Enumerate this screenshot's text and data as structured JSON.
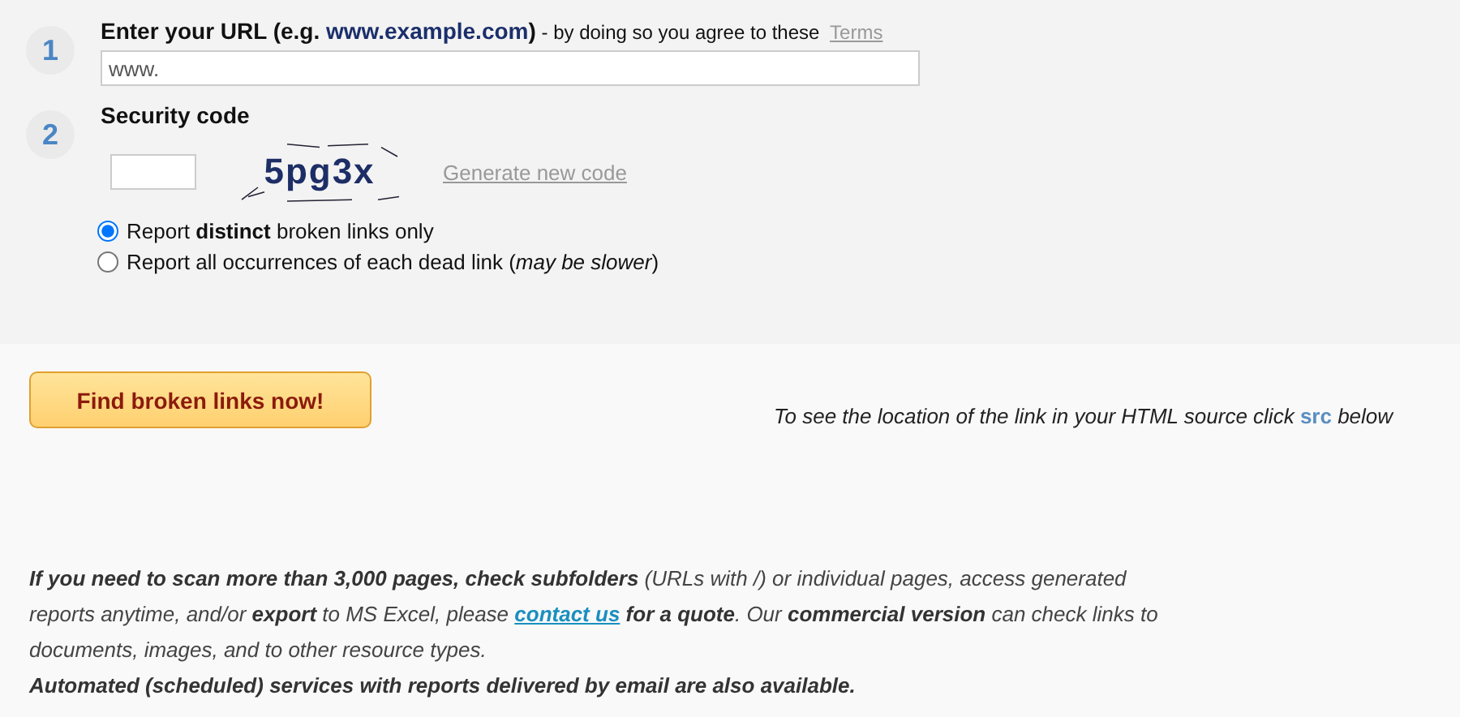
{
  "steps": [
    {
      "number": "1",
      "kind": "url",
      "title_before": "Enter your URL (e.g. ",
      "title_example": "www.example.com",
      "title_after": ")",
      "note": " - by doing so you agree to these ",
      "terms_link": "Terms",
      "field": {
        "value": "www."
      }
    },
    {
      "number": "2",
      "kind": "captcha",
      "title": "Security code",
      "captcha": "5pg3x",
      "generate_link": "Generate new code"
    }
  ],
  "report_options": [
    {
      "label": "Report **distinct** broken links only",
      "selected": true
    },
    {
      "label": "Report all occurrences of each dead link (*may be slower*)",
      "selected": false
    }
  ],
  "submit_button": "Find broken links now!",
  "hint": {
    "before": "To see the location of the link in your HTML source click ",
    "keyword": "src",
    "after": " below"
  },
  "info": {
    "before": "**If you need to scan more than 3,000 pages, check subfolders** (URLs with /) or individual pages, access generated reports anytime, and/or **export** to MS Excel, please ",
    "link": "contact us",
    "after": " **for a quote**. Our **commercial version** can check links to documents, images, and to other resource types.",
    "footer": "Automated (scheduled) services with reports delivered by email are also available."
  }
}
